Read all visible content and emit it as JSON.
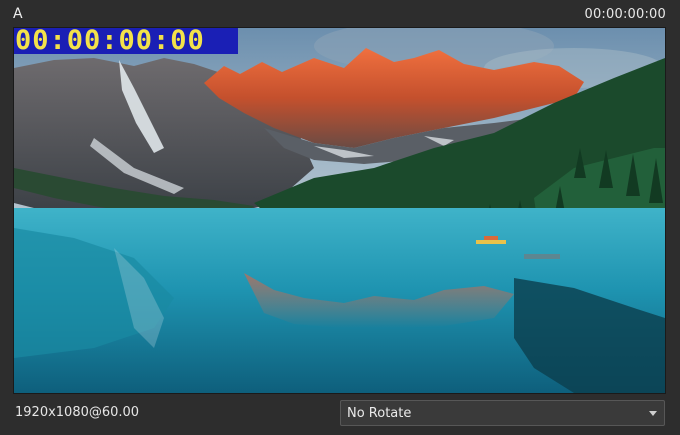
{
  "window": {
    "title": "A",
    "timecode": "00:00:00:00"
  },
  "preview": {
    "overlay_timecode": "00:00:00:00",
    "overlay_text_color": "#f3e24a",
    "overlay_bg_color": "#1a1fb5",
    "scene": "mountain lake with forest and snow peaks"
  },
  "footer": {
    "resolution": "1920x1080@60.00",
    "rotate": {
      "selected": "No Rotate",
      "icon": "chevron-down-icon"
    }
  }
}
